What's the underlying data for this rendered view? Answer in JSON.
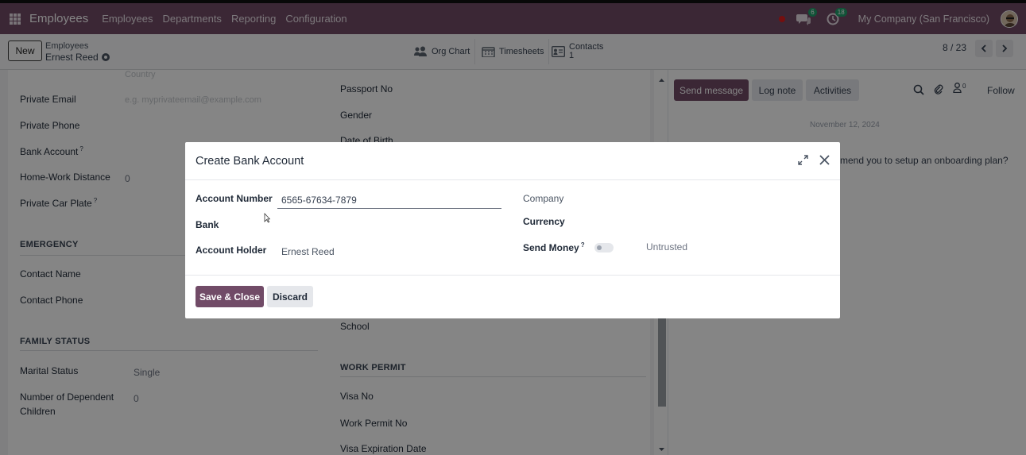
{
  "navbar": {
    "app_name": "Employees",
    "menu": [
      "Employees",
      "Departments",
      "Reporting",
      "Configuration"
    ],
    "messages_badge": "6",
    "activities_badge": "18",
    "company": "My Company (San Francisco)"
  },
  "control": {
    "new_label": "New",
    "breadcrumb_parent": "Employees",
    "record_name": "Ernest Reed",
    "smart_buttons": {
      "org_chart": "Org Chart",
      "timesheets": "Timesheets",
      "contacts": "Contacts",
      "contacts_count": "1"
    },
    "pager": "8 / 23"
  },
  "form": {
    "country_placeholder": "Country",
    "private_email_label": "Private Email",
    "private_email_placeholder": "e.g. myprivateemail@example.com",
    "private_phone_label": "Private Phone",
    "bank_account_label": "Bank Account",
    "help_mark": "?",
    "home_work_label": "Home-Work Distance",
    "home_work_value": "0",
    "car_plate_label": "Private Car Plate",
    "emergency_title": "EMERGENCY",
    "contact_name_label": "Contact Name",
    "contact_phone_label": "Contact Phone",
    "family_title": "FAMILY STATUS",
    "marital_label": "Marital Status",
    "marital_value": "Single",
    "dependents_label_1": "Number of Dependent",
    "dependents_label_2": "Children",
    "dependents_value": "0",
    "passport_label": "Passport No",
    "gender_label": "Gender",
    "dob_label": "Date of Birth",
    "school_label": "School",
    "work_permit_title": "WORK PERMIT",
    "visa_no_label": "Visa No",
    "work_permit_no_label": "Work Permit No",
    "visa_expiration_label": "Visa Expiration Date"
  },
  "chatter": {
    "send_message": "Send message",
    "log_note": "Log note",
    "activities": "Activities",
    "followers_count": "0",
    "follow": "Follow",
    "date": "November 12, 2024",
    "message_fragment": "mend you to setup an onboarding plan?"
  },
  "modal": {
    "title": "Create Bank Account",
    "account_number_label": "Account Number",
    "account_number_value": "6565-67634-7879",
    "bank_label": "Bank",
    "account_holder_label": "Account Holder",
    "account_holder_value": "Ernest Reed",
    "company_label": "Company",
    "currency_label": "Currency",
    "send_money_label": "Send Money",
    "send_money_help": "?",
    "trust_status": "Untrusted",
    "save_close": "Save & Close",
    "discard": "Discard"
  },
  "colors": {
    "brand": "#714b67",
    "navbar_text": "#ffffff",
    "badge": "#22a06b",
    "record_dot": "#e01e1e"
  }
}
